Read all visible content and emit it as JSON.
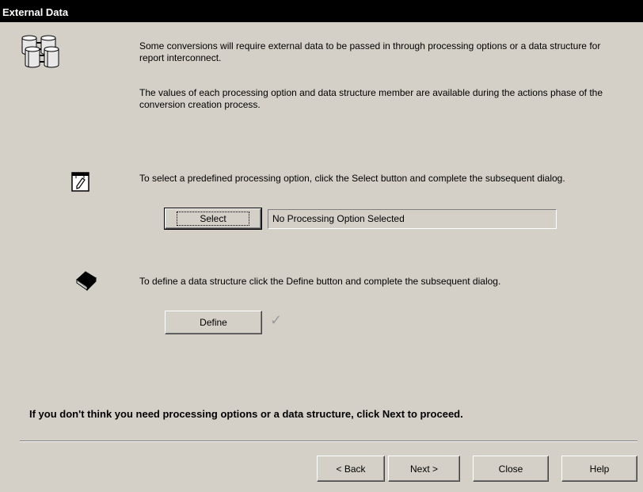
{
  "window": {
    "title": "External Data"
  },
  "intro": {
    "paragraph1": "Some conversions will require external data to be passed in through processing options or a data structure for report interconnect.",
    "paragraph2": "The values of each processing option and data structure member are available during the actions phase of the conversion creation process."
  },
  "processing_option": {
    "instruction": "To select a predefined processing option, click the Select button and complete the subsequent dialog.",
    "select_button_label": "Select",
    "status_value": "No Processing Option Selected"
  },
  "data_structure": {
    "instruction": "To define a data structure click the Define button and complete the subsequent dialog.",
    "define_button_label": "Define",
    "status_icon": "checkmark-icon"
  },
  "footer_note": "If you don't think you need processing options or a data structure, click Next to proceed.",
  "buttons": {
    "back_label": "< Back",
    "next_label": "Next >",
    "close_label": "Close",
    "help_label": "Help"
  }
}
